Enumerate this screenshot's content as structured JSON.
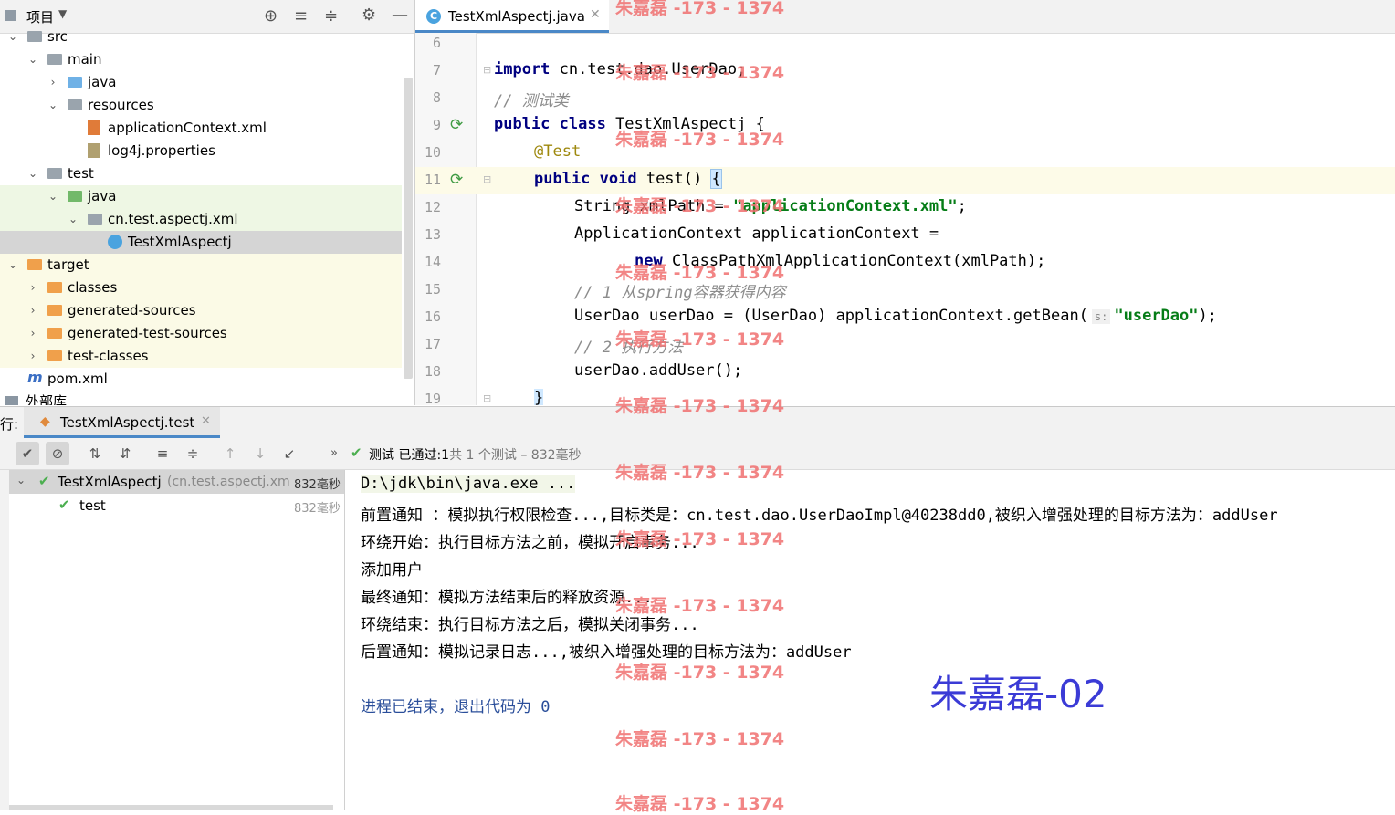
{
  "project_panel": {
    "title": "项目",
    "tree": [
      {
        "label": "src",
        "indent": 0,
        "arrow": "⌄",
        "icon": "grey"
      },
      {
        "label": "main",
        "indent": 1,
        "arrow": "⌄",
        "icon": "grey"
      },
      {
        "label": "java",
        "indent": 2,
        "arrow": "›",
        "icon": "blue"
      },
      {
        "label": "resources",
        "indent": 2,
        "arrow": "⌄",
        "icon": "grey"
      },
      {
        "label": "applicationContext.xml",
        "indent": 3,
        "arrow": "",
        "icon": "xml"
      },
      {
        "label": "log4j.properties",
        "indent": 3,
        "arrow": "",
        "icon": "props"
      },
      {
        "label": "test",
        "indent": 1,
        "arrow": "⌄",
        "icon": "grey"
      },
      {
        "label": "java",
        "indent": 2,
        "arrow": "⌄",
        "icon": "green"
      },
      {
        "label": "cn.test.aspectj.xml",
        "indent": 3,
        "arrow": "⌄",
        "icon": "grey"
      },
      {
        "label": "TestXmlAspectj",
        "indent": 4,
        "arrow": "",
        "icon": "class"
      },
      {
        "label": "target",
        "indent": 0,
        "arrow": "⌄",
        "icon": "orange"
      },
      {
        "label": "classes",
        "indent": 1,
        "arrow": "›",
        "icon": "orange"
      },
      {
        "label": "generated-sources",
        "indent": 1,
        "arrow": "›",
        "icon": "orange"
      },
      {
        "label": "generated-test-sources",
        "indent": 1,
        "arrow": "›",
        "icon": "orange"
      },
      {
        "label": "test-classes",
        "indent": 1,
        "arrow": "›",
        "icon": "orange"
      },
      {
        "label": "pom.xml",
        "indent": 0,
        "arrow": "",
        "icon": "maven"
      },
      {
        "label": "外部库",
        "indent": -1,
        "arrow": "",
        "icon": "lib"
      }
    ]
  },
  "editor": {
    "tab_label": "TestXmlAspectj.java",
    "lines": [
      {
        "n": "6"
      },
      {
        "n": "7"
      },
      {
        "n": "8"
      },
      {
        "n": "9"
      },
      {
        "n": "10"
      },
      {
        "n": "11"
      },
      {
        "n": "12"
      },
      {
        "n": "13"
      },
      {
        "n": "14"
      },
      {
        "n": "15"
      },
      {
        "n": "16"
      },
      {
        "n": "17"
      },
      {
        "n": "18"
      },
      {
        "n": "19"
      }
    ],
    "code": {
      "l7_kw": "import",
      "l7_rest": " cn.test.dao.UserDao;",
      "l8": "// 测试类",
      "l9_kw": "public class",
      "l9_rest": " TestXmlAspectj {",
      "l10": "@Test",
      "l11_kw": "public void",
      "l11_rest": " test() ",
      "l11_brace": "{",
      "l12_a": "String xmlPath = ",
      "l12_str": "\"applicationContext.xml\"",
      "l12_b": ";",
      "l13": "ApplicationContext applicationContext =",
      "l14_kw": "new",
      "l14_rest": " ClassPathXmlApplicationContext(xmlPath);",
      "l15": "// 1 从spring容器获得内容",
      "l16_a": "UserDao userDao = (UserDao) applicationContext.getBean(",
      "l16_hint": "s:",
      "l16_str": "\"userDao\"",
      "l16_b": ");",
      "l17": "// 2 执行方法",
      "l18": "userDao.addUser();",
      "l19": "}"
    }
  },
  "run_panel": {
    "prefix": "行:",
    "tab_label": "TestXmlAspectj.test",
    "status_prefix": "测试 已通过:",
    "status_count": "1",
    "status_detail": "共 1 个测试 – 832毫秒",
    "tree": [
      {
        "label": "TestXmlAspectj",
        "sub": "(cn.test.aspectj.xm",
        "time": "832毫秒"
      },
      {
        "label": "test",
        "sub": "",
        "time": "832毫秒"
      }
    ]
  },
  "console": {
    "lines": [
      "D:\\jdk\\bin\\java.exe ...",
      "前置通知 ：模拟执行权限检查...,目标类是：cn.test.dao.UserDaoImpl@40238dd0,被织入增强处理的目标方法为：addUser",
      "环绕开始：执行目标方法之前，模拟开启事务...",
      "添加用户",
      "最终通知：模拟方法结束后的释放资源...",
      "环绕结束：执行目标方法之后，模拟关闭事务...",
      "后置通知：模拟记录日志...,被织入增强处理的目标方法为：addUser",
      "",
      "进程已结束，退出代码为 0"
    ],
    "signature": "朱嘉磊-02"
  },
  "watermark": "朱嘉磊 -173 - 1374",
  "colors": {
    "keyword": "#000080",
    "string": "#067d17",
    "comment": "#8c8c8c",
    "annotation": "#9e880d",
    "watermark": "#f07070",
    "signature": "#3b3bd6",
    "success": "#4caf50"
  }
}
